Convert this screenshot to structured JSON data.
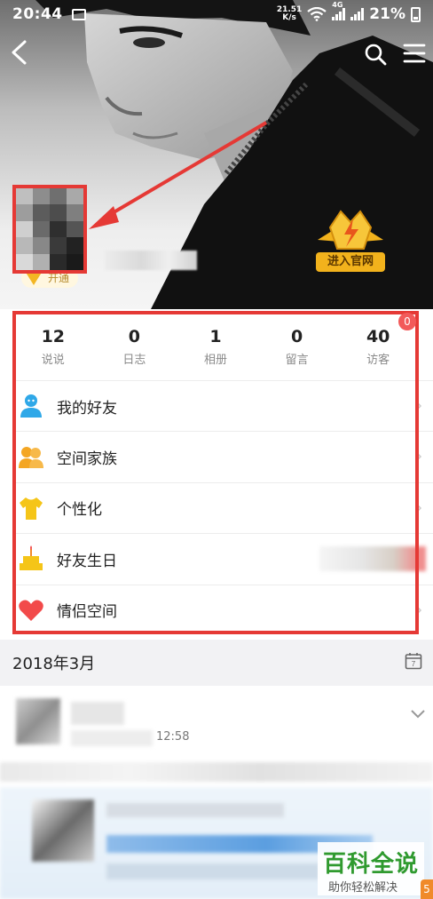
{
  "status_bar": {
    "time": "20:44",
    "net_speed_value": "21.51",
    "net_speed_unit": "K/s",
    "network_type": "4G",
    "battery": "21%"
  },
  "hero": {
    "vip_badge": "开通",
    "official_site_button": "进入官网"
  },
  "stats": [
    {
      "value": "12",
      "label": "说说"
    },
    {
      "value": "0",
      "label": "日志"
    },
    {
      "value": "1",
      "label": "相册"
    },
    {
      "value": "0",
      "label": "留言"
    },
    {
      "value": "40",
      "label": "访客"
    }
  ],
  "visitor_badge": "0",
  "menu": [
    {
      "label": "我的好友",
      "icon": "person-icon",
      "color": "#2fa8e8"
    },
    {
      "label": "空间家族",
      "icon": "group-icon",
      "color": "#f4a623"
    },
    {
      "label": "个性化",
      "icon": "shirt-icon",
      "color": "#f5c518"
    },
    {
      "label": "好友生日",
      "icon": "cake-icon",
      "color": "#f5c518"
    },
    {
      "label": "情侣空间",
      "icon": "heart-icon",
      "color": "#f24a4a"
    }
  ],
  "timeline": {
    "date": "2018年3月",
    "post_time": "12:58"
  },
  "watermark": {
    "title": "百科全说",
    "subtitle": "助你轻松解决",
    "corner": "5"
  },
  "colors": {
    "highlight_red": "#e53935",
    "badge_red": "#f25a5a",
    "gold": "#f2b21c"
  }
}
